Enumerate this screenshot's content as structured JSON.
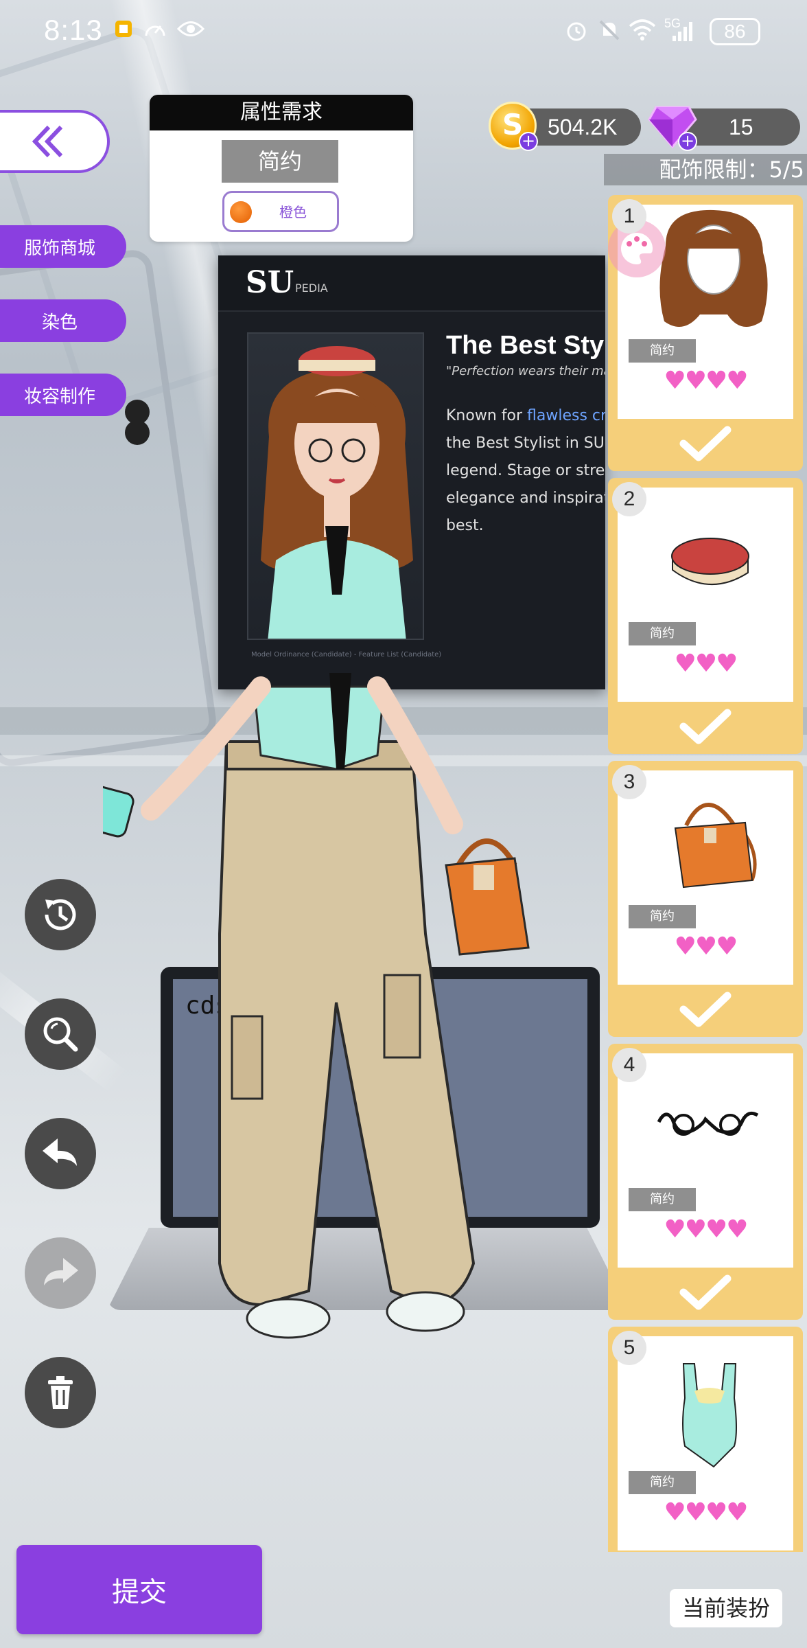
{
  "status_bar": {
    "time": "8:13",
    "battery": "86",
    "network": "5G",
    "icons": [
      "app-notification-icon",
      "speedometer-icon",
      "eye-icon",
      "alarm-icon",
      "mute-bell-icon",
      "wifi-icon",
      "signal-icon",
      "battery-icon"
    ]
  },
  "requirement": {
    "title": "属性需求",
    "style_label": "简约",
    "color_label": "橙色",
    "color_hex": "#f07a1a"
  },
  "side_nav": {
    "items": [
      {
        "label": "服饰商城"
      },
      {
        "label": "染色"
      },
      {
        "label": "妆容制作"
      }
    ]
  },
  "currency": {
    "coins": "504.2K",
    "gems": "15"
  },
  "accessory_limit": "配饰限制：5/5",
  "pedia": {
    "logo": "SU",
    "logo_sub": "PEDIA",
    "title": "The Best Stylis",
    "quote": "\"Perfection wears their mar",
    "body_lines": [
      {
        "pre": "Known for ",
        "highlight": "flawless craf"
      },
      {
        "pre": "the Best Stylist in SU Cit",
        "highlight": ""
      },
      {
        "pre": "legend. Stage or street a",
        "highlight": ""
      },
      {
        "pre": "elegance and inspiratio",
        "highlight": ""
      },
      {
        "pre": "best.",
        "highlight": ""
      }
    ],
    "footnote": "Model Ordinance (Candidate) - Feature List (Candidate)"
  },
  "laptop_text": "cdsg",
  "accessories": [
    {
      "number": "1",
      "tag": "简约",
      "hearts": "♥♥♥♥",
      "item": "wavy-wig",
      "checked": true
    },
    {
      "number": "2",
      "tag": "简约",
      "hearts": "♥♥♥",
      "item": "red-pillbox-hat",
      "checked": true
    },
    {
      "number": "3",
      "tag": "简约",
      "hearts": "♥♥♥",
      "item": "orange-handbag",
      "checked": true
    },
    {
      "number": "4",
      "tag": "简约",
      "hearts": "♥♥♥♥",
      "item": "black-glasses",
      "checked": true
    },
    {
      "number": "5",
      "tag": "简约",
      "hearts": "♥♥♥♥",
      "item": "mint-tank-top",
      "checked": false
    }
  ],
  "tools": [
    "history-icon",
    "zoom-icon",
    "undo-icon",
    "redo-icon",
    "trash-icon"
  ],
  "submit_label": "提交",
  "current_outfit_label": "当前装扮"
}
